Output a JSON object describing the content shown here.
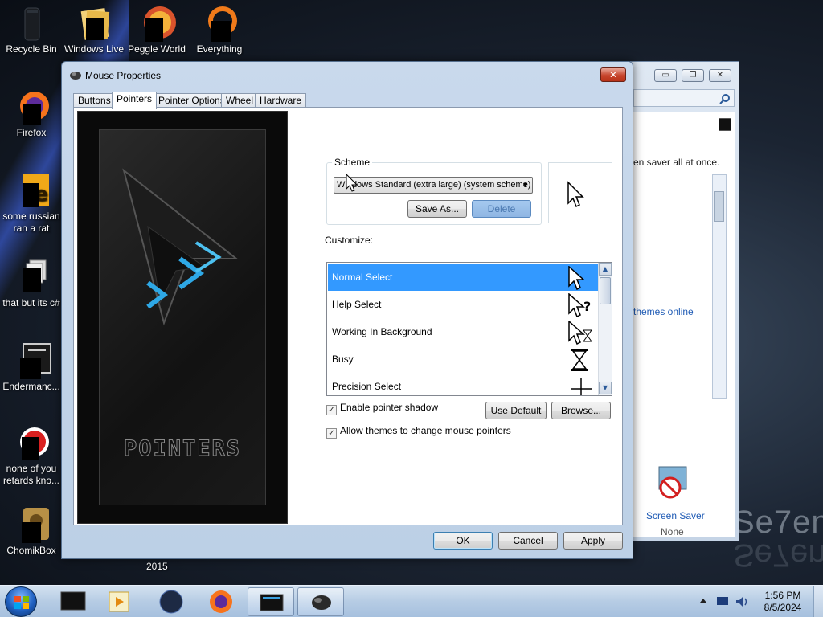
{
  "desktop": {
    "icons": [
      {
        "label": "Recycle Bin",
        "icon": "recycle-bin-icon"
      },
      {
        "label": "Windows Live",
        "icon": "windows-live-icon"
      },
      {
        "label": "Peggle World",
        "icon": "peggle-world-icon"
      },
      {
        "label": "Everything",
        "icon": "everything-search-icon"
      },
      {
        "label": "Firefox",
        "icon": "firefox-icon"
      },
      {
        "label": "some russian ran a rat",
        "icon": "shortcut-icon"
      },
      {
        "label": "that but its c#",
        "icon": "shortcut-icon"
      },
      {
        "label": "Endermanc...",
        "icon": "shortcut-icon"
      },
      {
        "label": "none of you retards kno...",
        "icon": "shortcut-icon"
      },
      {
        "label": "ChomikBox",
        "icon": "chomikbox-icon"
      }
    ],
    "extra_label": "2015",
    "wallpaper_text": "Se7en"
  },
  "background_window": {
    "description_fragment": "en saver all at once.",
    "themes_link": "themes online",
    "screen_saver_label": "Screen Saver",
    "screen_saver_value": "None",
    "buttons": [
      "▭",
      "❐",
      "✕"
    ]
  },
  "dialog": {
    "title": "Mouse Properties",
    "close_glyph": "✕",
    "tabs": [
      {
        "label": "Buttons",
        "active": false
      },
      {
        "label": "Pointers",
        "active": true
      },
      {
        "label": "Pointer Options",
        "active": false
      },
      {
        "label": "Wheel",
        "active": false
      },
      {
        "label": "Hardware",
        "active": false
      }
    ],
    "preview_wordmark": "POINTERS",
    "scheme": {
      "group_label": "Scheme",
      "selected": "Windows Standard (extra large) (system scheme)",
      "save_as": "Save As...",
      "delete": "Delete"
    },
    "customize_label": "Customize:",
    "cursors": [
      {
        "name": "Normal Select",
        "selected": true,
        "icon": "arrow-cursor-icon"
      },
      {
        "name": "Help Select",
        "selected": false,
        "icon": "help-cursor-icon"
      },
      {
        "name": "Working In Background",
        "selected": false,
        "icon": "working-cursor-icon"
      },
      {
        "name": "Busy",
        "selected": false,
        "icon": "hourglass-cursor-icon"
      },
      {
        "name": "Precision Select",
        "selected": false,
        "icon": "crosshair-cursor-icon"
      }
    ],
    "enable_shadow": {
      "label": "Enable pointer shadow",
      "checked": true
    },
    "allow_themes": {
      "label": "Allow themes to change mouse pointers",
      "checked": true
    },
    "use_default": "Use Default",
    "browse": "Browse...",
    "ok": "OK",
    "cancel": "Cancel",
    "apply": "Apply"
  },
  "taskbar": {
    "time": "1:56 PM",
    "date": "8/5/2024",
    "apps": [
      "start-orb",
      "media-center-icon",
      "media-player-icon",
      "globe-icon",
      "firefox-icon",
      "monitor-app-icon",
      "mouse-properties-icon"
    ]
  },
  "colors": {
    "selection": "#3399ff",
    "close_button": "#c7452d",
    "taskbar": "#b6cce4"
  }
}
